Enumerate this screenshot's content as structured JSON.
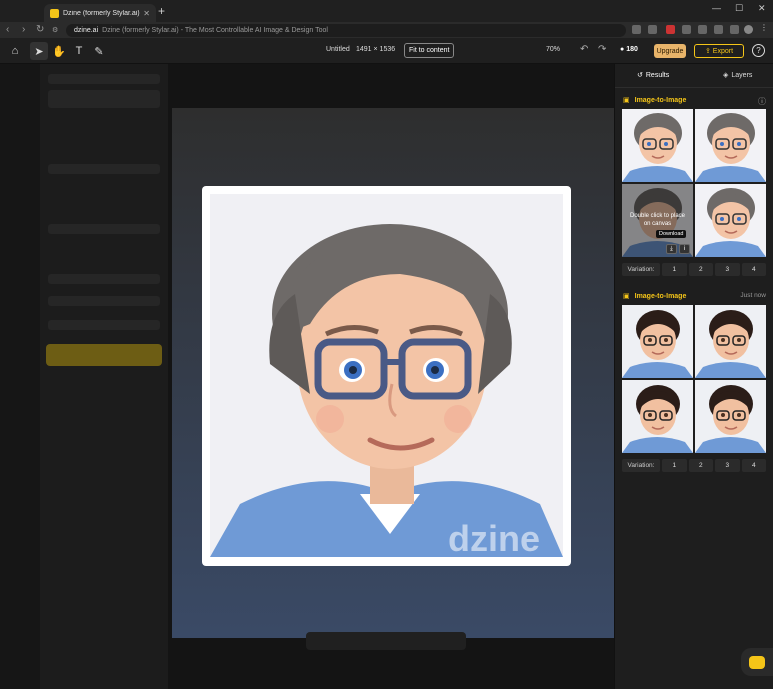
{
  "browser": {
    "tab_title": "Dzine (formerly Stylar.ai) - The M",
    "url_host": "dzine.ai",
    "url_rest": "Dzine (formerly Stylar.ai) - The Most Controllable AI Image & Design Tool"
  },
  "toolbar": {
    "doc_title": "Untitled",
    "doc_size": "1491 × 1536",
    "fit_label": "Fit to content",
    "zoom": "70%",
    "credits": "180",
    "upgrade_label": "Upgrade",
    "export_label": "Export",
    "help_label": "?"
  },
  "canvas": {
    "watermark": "dzine"
  },
  "right_panel": {
    "tabs": [
      "Results",
      "Layers"
    ],
    "sections": [
      {
        "title": "Image-to-Image",
        "time": "",
        "overlay_text": "Double click to place on canvas",
        "tooltip": "Download",
        "variation_label": "Variation:",
        "variations": [
          "1",
          "2",
          "3",
          "4"
        ]
      },
      {
        "title": "Image-to-Image",
        "time": "Just now",
        "variation_label": "Variation:",
        "variations": [
          "1",
          "2",
          "3",
          "4"
        ]
      }
    ]
  },
  "colors": {
    "accent": "#f5c518",
    "upgrade": "#e8b46a",
    "hair_gray": "#6e6a68",
    "hair_dark": "#2b1d18",
    "shirt": "#6f9ad6"
  }
}
